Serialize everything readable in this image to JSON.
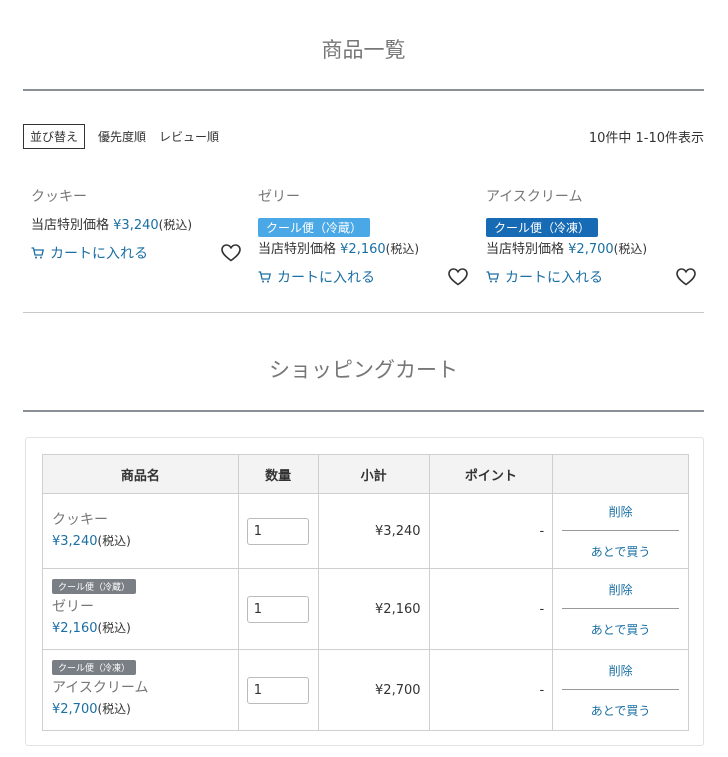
{
  "product_list": {
    "title": "商品一覧",
    "sort": {
      "label": "並び替え",
      "options": [
        "優先度順",
        "レビュー順"
      ]
    },
    "result_count": "10件中 1-10件表示",
    "price_prefix": "当店特別価格",
    "tax_label": "(税込)",
    "cart_button_label": "カートに入れる",
    "items": [
      {
        "name": "クッキー",
        "badge": "",
        "price": "¥3,240"
      },
      {
        "name": "ゼリー",
        "badge": "クール便（冷蔵）",
        "badge_color": "#4aa8e6",
        "price": "¥2,160"
      },
      {
        "name": "アイスクリーム",
        "badge": "クール便（冷凍）",
        "badge_color": "#176ab4",
        "price": "¥2,700"
      }
    ]
  },
  "cart": {
    "title": "ショッピングカート",
    "headers": [
      "商品名",
      "数量",
      "小計",
      "ポイント",
      ""
    ],
    "tax_label": "(税込)",
    "delete_label": "削除",
    "later_label": "あとで買う",
    "rows": [
      {
        "badge": "",
        "name": "クッキー",
        "price": "¥3,240",
        "qty": "1",
        "subtotal": "¥3,240",
        "points": "-"
      },
      {
        "badge": "クール便（冷蔵）",
        "name": "ゼリー",
        "price": "¥2,160",
        "qty": "1",
        "subtotal": "¥2,160",
        "points": "-"
      },
      {
        "badge": "クール便（冷凍）",
        "name": "アイスクリーム",
        "price": "¥2,700",
        "qty": "1",
        "subtotal": "¥2,700",
        "points": "-"
      }
    ]
  },
  "colors": {
    "link": "#1a6fa3",
    "rule": "#8a9096",
    "badge_gray": "#7a7f85"
  },
  "icons": {
    "cart": "cart-icon",
    "favorite": "heart-icon"
  }
}
